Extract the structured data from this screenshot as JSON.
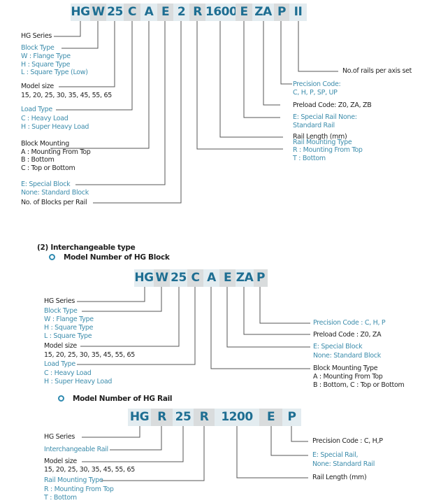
{
  "section1": {
    "code_cells": [
      "HG",
      "W",
      "25",
      "C",
      "A",
      "E",
      "2",
      "R",
      "1600",
      "E",
      "ZA",
      "P",
      "II"
    ],
    "left_labels": {
      "hg_series": "HG Series",
      "block_type": [
        "Block  Type",
        "W : Flange  Type",
        "H : Square Type",
        "L : Square Type (Low)"
      ],
      "model_size": [
        "Model size",
        "15, 20, 25, 30, 35, 45, 55, 65"
      ],
      "load_type": [
        "Load Type",
        "C : Heavy Load",
        "H : Super Heavy Load"
      ],
      "block_mounting": [
        "Block Mounting",
        "A : Mounting From Top",
        "B : Bottom",
        "C : Top or Bottom"
      ],
      "special_block": [
        "E: Special Block",
        "None: Standard Block"
      ],
      "blocks_per_rail": "No. of Blocks per Rail"
    },
    "right_labels": {
      "rails_per_axis": "No.of rails per axis set",
      "precision_code": [
        "Precision Code:",
        "C, H, P, SP, UP"
      ],
      "preload_code": "Preload Code: Z0, ZA, ZB",
      "special_rail": [
        "E: Special Rail None:",
        "Standard Rail"
      ],
      "rail_length": "Rail Length (mm)",
      "rail_mounting": [
        "Rail Mounting Type",
        "R : Mounting From Top",
        "T : Bottom"
      ]
    }
  },
  "section2": {
    "heading": "(2) Interchangeable type",
    "subheading": "Model Number of HG Block",
    "code_cells": [
      "HG",
      "W",
      "25",
      "C",
      "A",
      "E",
      "ZA",
      "P"
    ],
    "left_labels": {
      "hg_series": "HG Series",
      "block_type": [
        "Block  Type",
        "W : Flange  Type",
        "H : Square Type",
        "L : Square Type"
      ],
      "model_size": [
        "Model size",
        "15, 20, 25, 30, 35, 45, 55, 65"
      ],
      "load_type": [
        "Load Type",
        "C : Heavy Load",
        "H : Super Heavy Load"
      ]
    },
    "right_labels": {
      "precision_code": "Precision Code : C, H, P",
      "preload_code": "Preload Code : Z0, ZA",
      "special_block": [
        "E: Special Block",
        "None: Standard Block"
      ],
      "block_mounting": [
        "Block Mounting Type",
        "A : Mounting From Top",
        "B : Bottom, C : Top or Bottom"
      ]
    }
  },
  "section3": {
    "subheading": "Model Number of HG Rail",
    "code_cells": [
      "HG",
      "R",
      "25",
      "R",
      "1200",
      "E",
      "P"
    ],
    "left_labels": {
      "hg_series": "HG Series",
      "interchangeable_rail": "Interchangeable Rail",
      "model_size": [
        "Model size",
        "15, 20, 25, 30, 35, 45, 55, 65"
      ],
      "rail_mounting": [
        "Rail Mounting Type",
        "R : Mounting From Top",
        "T : Bottom"
      ]
    },
    "right_labels": {
      "precision_code": "Precision Code : C, H,P",
      "special_rail": [
        "E: Special Rail,",
        "None: Standard Rail"
      ],
      "rail_length": "Rail Length (mm)"
    }
  }
}
